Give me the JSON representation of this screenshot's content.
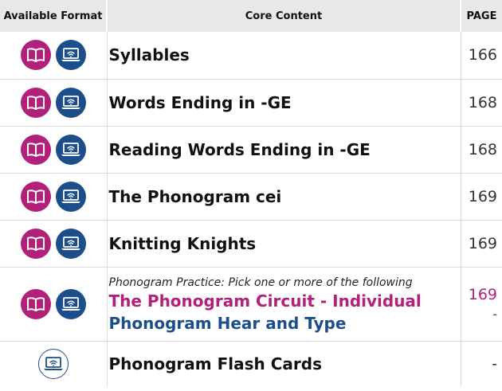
{
  "header": {
    "col1": "Available Format",
    "col2": "Core Content",
    "col3": "PAGE"
  },
  "colors": {
    "book_badge": "#b1207a",
    "digital_badge": "#1d4e8c",
    "header_bg": "#e8e8e8"
  },
  "icons": {
    "book": "open-book-icon",
    "digital": "laptop-wifi-icon"
  },
  "rows": [
    {
      "title": "Syllables",
      "page": "166",
      "formats": [
        "book",
        "digital"
      ]
    },
    {
      "title": "Words Ending in -GE",
      "page": "168",
      "formats": [
        "book",
        "digital"
      ]
    },
    {
      "title": "Reading Words Ending in -GE",
      "page": "168",
      "formats": [
        "book",
        "digital"
      ]
    },
    {
      "title": "The Phonogram cei",
      "page": "169",
      "formats": [
        "book",
        "digital"
      ]
    },
    {
      "title": "Knitting Knights",
      "page": "169",
      "formats": [
        "book",
        "digital"
      ]
    }
  ],
  "practice": {
    "note": "Phonogram Practice: Pick one or more of the following",
    "option1": "The Phonogram Circuit - Individual",
    "option1_page": "169",
    "option2": "Phonogram Hear and Type",
    "option2_page": "-",
    "formats": [
      "book",
      "digital"
    ]
  },
  "last_row": {
    "title": "Phonogram Flash Cards",
    "page": "-",
    "formats": [
      "digital-outline"
    ]
  }
}
